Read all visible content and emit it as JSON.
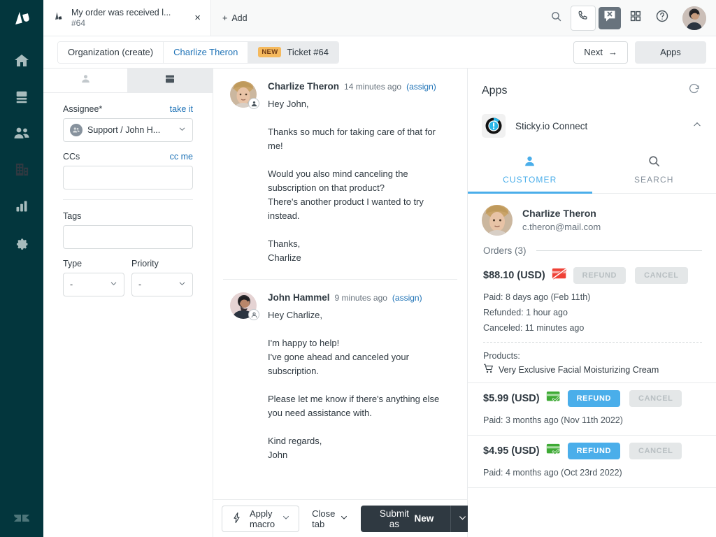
{
  "rail": {
    "logo_name": "zendesk-logo",
    "items": [
      {
        "name": "home",
        "icon": "home-icon"
      },
      {
        "name": "views",
        "icon": "views-icon"
      },
      {
        "name": "customers",
        "icon": "customers-icon"
      },
      {
        "name": "organizations",
        "icon": "organizations-icon"
      },
      {
        "name": "reporting",
        "icon": "reporting-icon"
      },
      {
        "name": "admin",
        "icon": "gear-icon"
      }
    ]
  },
  "topbar": {
    "tab": {
      "title": "My order was received l...",
      "number": "#64",
      "close_label": "×"
    },
    "add_label": "Add",
    "add_plus": "+",
    "icons": [
      "search-icon",
      "phone-icon",
      "chat-closed-icon",
      "apps-grid-icon",
      "help-icon",
      "user-avatar"
    ]
  },
  "breadcrumb": {
    "items": [
      {
        "label": "Organization (create)",
        "style": "plain"
      },
      {
        "label": "Charlize Theron",
        "style": "link"
      },
      {
        "label": "Ticket #64",
        "style": "current",
        "badge": "NEW"
      }
    ],
    "next_label": "Next",
    "next_arrow": "→",
    "apps_label": "Apps"
  },
  "properties": {
    "tabs": [
      {
        "name": "user-tab",
        "icon": "person-icon",
        "active": false
      },
      {
        "name": "ticket-tab",
        "icon": "ticket-icon",
        "active": true
      }
    ],
    "assignee": {
      "label": "Assignee*",
      "action": "take it",
      "value": "Support / John H...",
      "avatar": "group-avatar"
    },
    "ccs": {
      "label": "CCs",
      "action": "cc me",
      "value": "",
      "placeholder": ""
    },
    "tags": {
      "label": "Tags",
      "value": "",
      "placeholder": ""
    },
    "type": {
      "label": "Type",
      "value": "-"
    },
    "priority": {
      "label": "Priority",
      "value": "-"
    }
  },
  "conversation": {
    "comments": [
      {
        "author": "Charlize Theron",
        "time": "14 minutes ago",
        "assign": "(assign)",
        "avatar": "charlize-avatar",
        "role_icon": "end-user-icon",
        "body": "Hey John,\n\nThanks so much for taking care of that for me!\n\nWould you also mind canceling the subscription on that product?\nThere's another product I wanted to try instead.\n\nThanks,\nCharlize"
      },
      {
        "author": "John Hammel",
        "time": "9 minutes ago",
        "assign": "(assign)",
        "avatar": "john-avatar",
        "role_icon": "agent-icon",
        "body": "Hey Charlize,\n\nI'm happy to help!\nI've gone ahead and canceled your subscription.\n\nPlease let me know if there's anything else you need assistance with.\n\nKind regards,\nJohn"
      }
    ]
  },
  "footer": {
    "macro_label": "Apply macro",
    "macro_icon": "macro-bolt-icon",
    "close_tab_label": "Close tab",
    "submit_prefix": "Submit as ",
    "submit_status": "New"
  },
  "apps_panel": {
    "title": "Apps",
    "refresh_icon": "refresh-icon",
    "app": {
      "name": "Sticky.io Connect",
      "logo": "stickyio-logo",
      "collapse_icon": "chevron-up-icon"
    },
    "tabs": [
      {
        "label": "CUSTOMER",
        "icon": "person-icon",
        "selected": true
      },
      {
        "label": "SEARCH",
        "icon": "search-icon",
        "selected": false
      }
    ],
    "customer": {
      "name": "Charlize Theron",
      "email": "c.theron@mail.com",
      "avatar": "charlize-avatar"
    },
    "orders_label": "Orders (3)",
    "orders": [
      {
        "amount": "$88.10 (USD)",
        "status_icon": "card-declined-icon",
        "status_color": "#e8453c",
        "refund_label": "REFUND",
        "refund_enabled": false,
        "cancel_label": "CANCEL",
        "cancel_enabled": false,
        "lines": [
          "Paid: 8 days ago (Feb 11th)",
          "Refunded: 1 hour ago",
          "Canceled: 11 minutes ago"
        ],
        "products_label": "Products:",
        "products": [
          "Very Exclusive Facial Moisturizing Cream"
        ],
        "product_icon": "cart-icon"
      },
      {
        "amount": "$5.99 (USD)",
        "status_icon": "card-paid-icon",
        "status_color": "#3eaa35",
        "refund_label": "REFUND",
        "refund_enabled": true,
        "cancel_label": "CANCEL",
        "cancel_enabled": false,
        "lines": [
          "Paid: 3 months ago (Nov 11th 2022)"
        ],
        "products_label": "",
        "products": [],
        "product_icon": ""
      },
      {
        "amount": "$4.95 (USD)",
        "status_icon": "card-paid-icon",
        "status_color": "#3eaa35",
        "refund_label": "REFUND",
        "refund_enabled": true,
        "cancel_label": "CANCEL",
        "cancel_enabled": false,
        "lines": [
          "Paid: 4 months ago (Oct 23rd 2022)"
        ],
        "products_label": "",
        "products": [],
        "product_icon": ""
      }
    ]
  },
  "colors": {
    "rail_bg": "#03363d",
    "accent_link": "#1f73b7",
    "app_accent": "#4aaeea",
    "submit_bg": "#2f3941",
    "badge_new": "#f5b95d"
  }
}
